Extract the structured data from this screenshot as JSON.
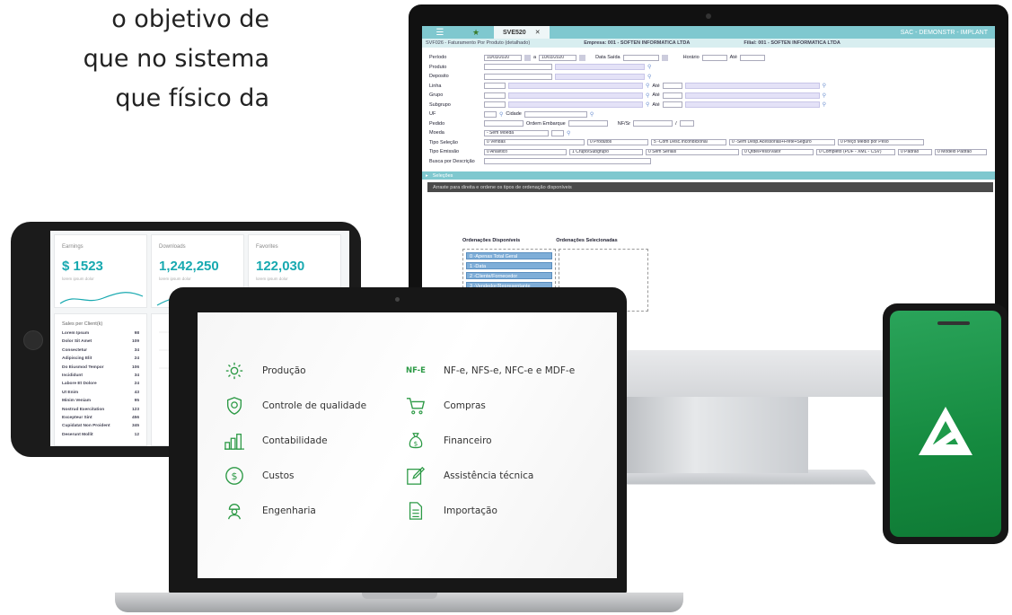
{
  "intro": {
    "line1": "o objetivo de",
    "line2": "que no sistema",
    "line3": "que físico da"
  },
  "colors": {
    "erp_teal": "#7fc8cf",
    "brand_green": "#2d9a46",
    "tablet_accent": "#18a9b0"
  },
  "erp": {
    "tabs": [
      "☰",
      "★",
      "SVE520",
      "✕"
    ],
    "top_right": "SAC - DEMONSTR - IMPLANT",
    "subheader": {
      "title": "SVF026 - Faturamento Por Produto (detalhado)",
      "empresa": "Empresa: 001 - SOFTEN INFORMATICA LTDA",
      "filial": "Filial: 001 - SOFTEN INFORMATICA LTDA"
    },
    "fields": {
      "periodo": "Período",
      "periodo_de": "10/03/2020",
      "periodo_a": "a",
      "periodo_ate": "10/03/2020",
      "data_saida": "Data Saída",
      "horario": "Horário",
      "ate": "Até",
      "produto": "Produto",
      "deposito": "Deposito",
      "linha": "Linha",
      "grupo": "Grupo",
      "subgrupo": "Subgrupo",
      "ate2": "Até",
      "uf": "UF",
      "cidade": "Cidade",
      "pedido": "Pedido",
      "ordem_embarque": "Ordem Embarque",
      "nf_sr": "NF/Sr",
      "moeda": "Moeda",
      "moeda_value": "- Sem Moeda",
      "tipo_selecao": "Tipo Seleção",
      "tipo_emissao": "Tipo Emissão",
      "busca": "Busca por Descrição"
    },
    "selects": {
      "vendas": "0 Vendas",
      "produtos": "0 Produtos",
      "com_desc": "5 -Com Desc.Incondicional",
      "sem_desp": "0 -Sem Desp.Acessorias+Frete+Seguro",
      "preco_medio": "0 Preço Médio por Peso",
      "analitico": "0 Analítico",
      "crupo": "1 Crupo/Subgrupo",
      "sem_seriais": "0 Sem Seriais",
      "qtde": "0 Qtde/Peso/Valor",
      "completo": "0 Completo (PDF - XML - CSV)",
      "padrao": "0 Padrão",
      "modelo": "0 Modelo Padrão"
    },
    "selecoes_bar": "Seleções",
    "dark_bar": "Arraste para direita e ordene os tipos de ordenação disponíveis",
    "ordenacoes_disponiveis": "Ordenações Disponíveis",
    "ordenacoes_selecionadas": "Ordenações Selecionadas",
    "ordenacoes": [
      "0 -Apenas Total Geral",
      "1 -Data",
      "2 -Cliente/Fornecedor",
      "3 -Vendedor/Representante"
    ]
  },
  "tablet": {
    "cards": [
      {
        "label": "Earnings",
        "value": "$ 1523",
        "sub": "lorem ipsum dolor"
      },
      {
        "label": "Downloads",
        "value": "1,242,250",
        "sub": "lorem ipsum dolor"
      },
      {
        "label": "Favorites",
        "value": "122,030",
        "sub": "lorem ipsum dolor"
      }
    ],
    "list_title": "Sales per Client(k)",
    "list": [
      {
        "name": "Lorem Ipsum",
        "value": "98"
      },
      {
        "name": "Dolor Sit Amet",
        "value": "109"
      },
      {
        "name": "Consectetur",
        "value": "34"
      },
      {
        "name": "Adipiscing Elit",
        "value": "24"
      },
      {
        "name": "Do Eiusmod Tempor",
        "value": "106"
      },
      {
        "name": "Incididunt",
        "value": "34"
      },
      {
        "name": "Labore Et Dolore",
        "value": "24"
      },
      {
        "name": "Ut Enim",
        "value": "43"
      },
      {
        "name": "Minim Veniam",
        "value": "95"
      },
      {
        "name": "Nostrud Exercitation",
        "value": "123"
      },
      {
        "name": "Excepteur Sint",
        "value": "456"
      },
      {
        "name": "Cupidatat Non Proident",
        "value": "345"
      },
      {
        "name": "Deserunt Mollit",
        "value": "12"
      }
    ]
  },
  "laptop": {
    "left_modules": [
      {
        "icon": "gear-icon",
        "label": "Produção"
      },
      {
        "icon": "shield-icon",
        "label": "Controle de qualidade"
      },
      {
        "icon": "building-chart-icon",
        "label": "Contabilidade"
      },
      {
        "icon": "dollar-icon",
        "label": "Custos"
      },
      {
        "icon": "engineer-icon",
        "label": "Engenharia"
      }
    ],
    "right_modules": [
      {
        "icon": "nfe-icon",
        "icon_text": "NF-E",
        "label": "NF-e, NFS-e, NFC-e e MDF-e"
      },
      {
        "icon": "cart-icon",
        "label": "Compras"
      },
      {
        "icon": "money-bag-icon",
        "label": "Financeiro"
      },
      {
        "icon": "edit-icon",
        "label": "Assistência técnica"
      },
      {
        "icon": "document-icon",
        "label": "Importação"
      }
    ]
  },
  "phone": {
    "logo": "brand-logo-icon"
  }
}
